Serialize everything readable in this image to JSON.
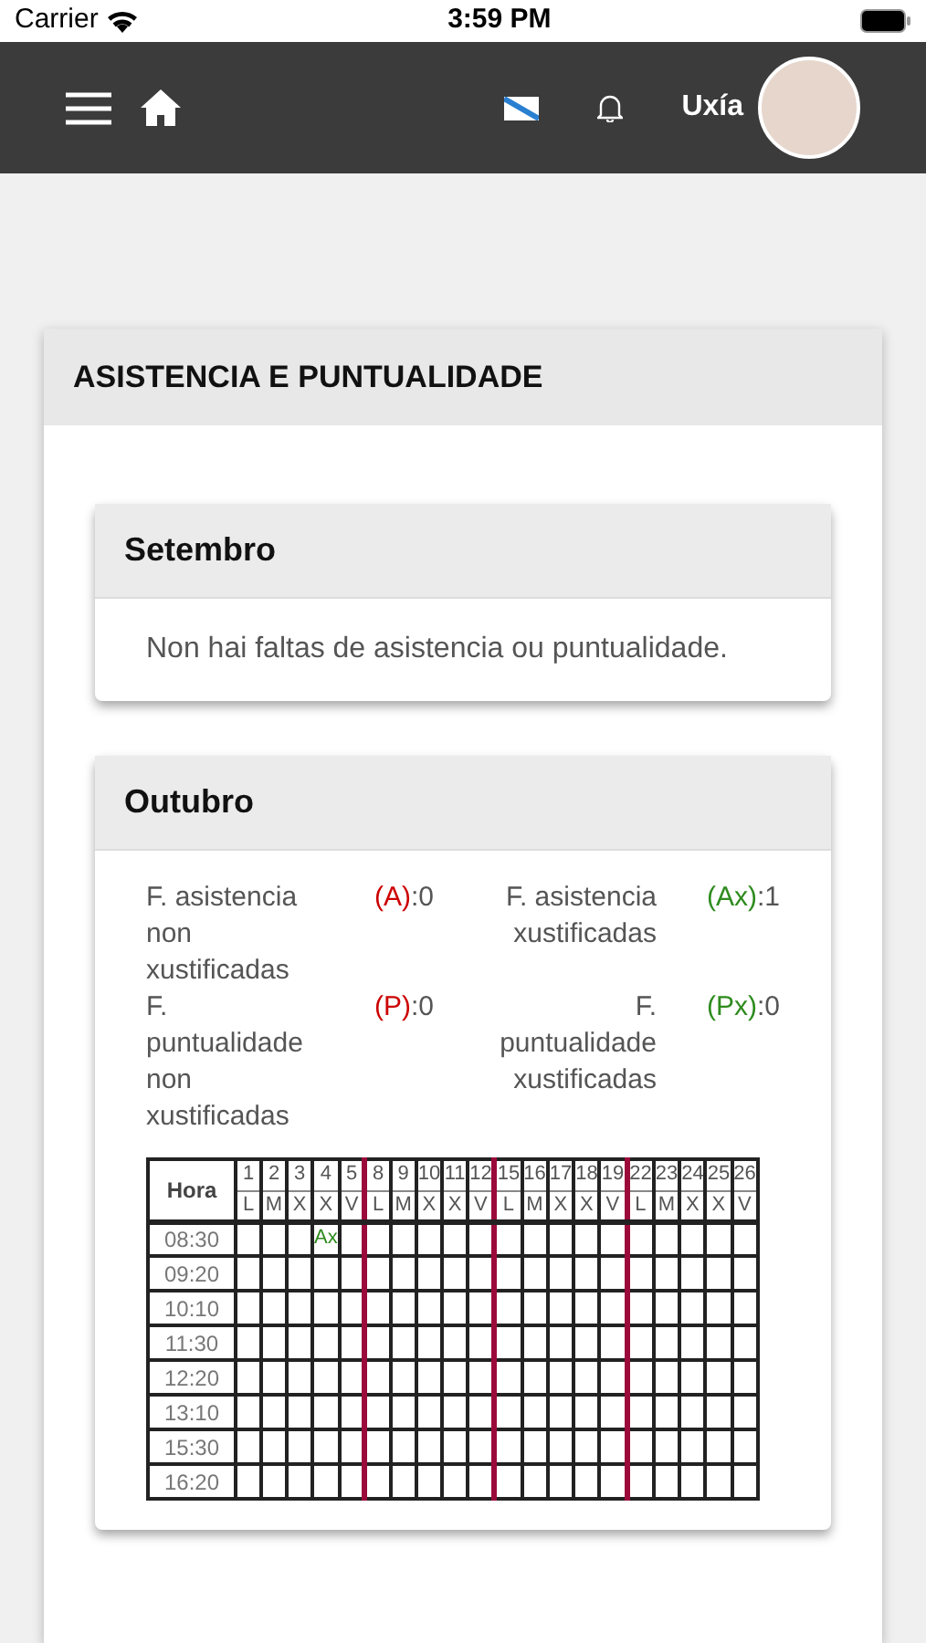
{
  "status_bar": {
    "carrier": "Carrier",
    "time": "3:59 PM"
  },
  "nav": {
    "user_name": "Uxía"
  },
  "panel": {
    "title": "ASISTENCIA E PUNTUALIDADE"
  },
  "months": [
    {
      "title": "Setembro",
      "kind": "message",
      "message": "Non hai faltas de asistencia ou puntualidade."
    },
    {
      "title": "Outubro",
      "kind": "summary",
      "stats": [
        {
          "label": "F. asistencia non xustificadas",
          "code": "(A)",
          "value": ":0",
          "color": "#cc0000"
        },
        {
          "label": "F. asistencia xustificadas",
          "code": "(Ax)",
          "value": ":1",
          "color": "#2e8b1e"
        },
        {
          "label": "F. puntualidade non xustificadas",
          "code": "(P)",
          "value": ":0",
          "color": "#cc0000"
        },
        {
          "label": "F. puntualidade xustificadas",
          "code": "(Px)",
          "value": ":0",
          "color": "#2e8b1e"
        }
      ],
      "table": {
        "hour_header": "Hora",
        "weeks": [
          {
            "days": [
              {
                "number": "1",
                "letter": "L"
              },
              {
                "number": "2",
                "letter": "M"
              },
              {
                "number": "3",
                "letter": "X"
              },
              {
                "number": "4",
                "letter": "X"
              },
              {
                "number": "5",
                "letter": "V"
              }
            ]
          },
          {
            "days": [
              {
                "number": "8",
                "letter": "L"
              },
              {
                "number": "9",
                "letter": "M"
              },
              {
                "number": "10",
                "letter": "X"
              },
              {
                "number": "11",
                "letter": "X"
              },
              {
                "number": "12",
                "letter": "V"
              }
            ]
          },
          {
            "days": [
              {
                "number": "15",
                "letter": "L"
              },
              {
                "number": "16",
                "letter": "M"
              },
              {
                "number": "17",
                "letter": "X"
              },
              {
                "number": "18",
                "letter": "X"
              },
              {
                "number": "19",
                "letter": "V"
              }
            ]
          },
          {
            "days": [
              {
                "number": "22",
                "letter": "L"
              },
              {
                "number": "23",
                "letter": "M"
              },
              {
                "number": "24",
                "letter": "X"
              },
              {
                "number": "25",
                "letter": "X"
              },
              {
                "number": "26",
                "letter": "V"
              }
            ]
          }
        ],
        "rows": [
          {
            "hour": "08:30",
            "cells": [
              null,
              null,
              null,
              "Ax",
              null,
              null,
              null,
              null,
              null,
              null,
              null,
              null,
              null,
              null,
              null,
              null,
              null,
              null,
              null,
              null
            ]
          },
          {
            "hour": "09:20"
          },
          {
            "hour": "10:10"
          },
          {
            "hour": "11:30"
          },
          {
            "hour": "12:20"
          },
          {
            "hour": "13:10"
          },
          {
            "hour": "15:30"
          },
          {
            "hour": "16:20"
          }
        ]
      }
    }
  ]
}
